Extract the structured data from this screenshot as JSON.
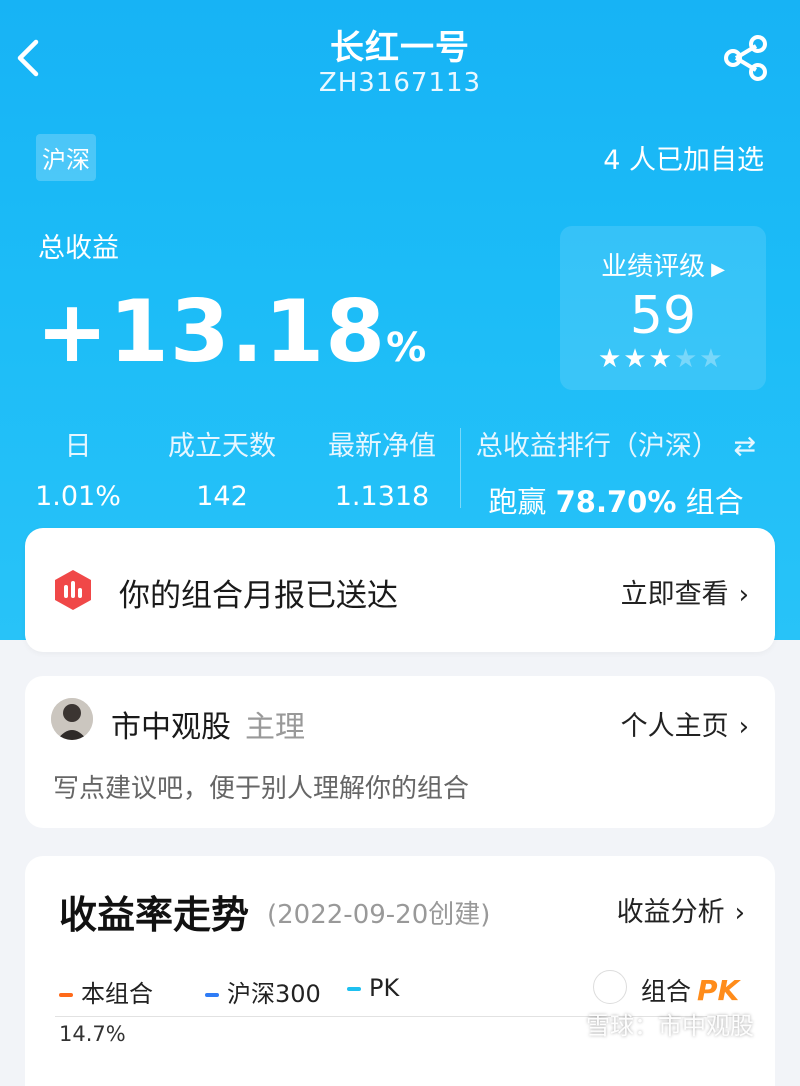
{
  "header": {
    "title": "长红一号",
    "code": "ZH3167113"
  },
  "summary": {
    "market_badge": "沪深",
    "watchers": "4 人已加自选",
    "total_return_label": "总收益",
    "total_return_value": "+13.18",
    "total_return_unit": "%"
  },
  "rating": {
    "label": "业绩评级",
    "score": "59",
    "stars_filled": 3,
    "stars_total": 5
  },
  "stats": {
    "daily": {
      "label": "日",
      "value": "1.01%"
    },
    "days": {
      "label": "成立天数",
      "value": "142"
    },
    "nav": {
      "label": "最新净值",
      "value": "1.1318"
    },
    "rank": {
      "label": "总收益排行（沪深）",
      "prefix": "跑赢",
      "value": "78.70%",
      "suffix": "组合"
    }
  },
  "report": {
    "text": "你的组合月报已送达",
    "link": "立即查看"
  },
  "owner": {
    "name": "市中观股",
    "role": "主理",
    "link": "个人主页",
    "hint": "写点建议吧，便于别人理解你的组合"
  },
  "trend": {
    "title": "收益率走势",
    "created": "(2022-09-20创建)",
    "link": "收益分析",
    "legend": [
      {
        "name": "本组合",
        "color": "#ff6a1a"
      },
      {
        "name": "沪深300",
        "color": "#2f7cf6"
      },
      {
        "name": "PK",
        "color": "#1ec0f0"
      }
    ],
    "pk_label": "组合",
    "pk_badge": "PK",
    "y_top_tick": "14.7%"
  },
  "watermark": "雪球：市中观股",
  "colors": {
    "hero": "#17b3f5",
    "report_icon": "#f04848",
    "pk_orange": "#ff8c1a"
  }
}
